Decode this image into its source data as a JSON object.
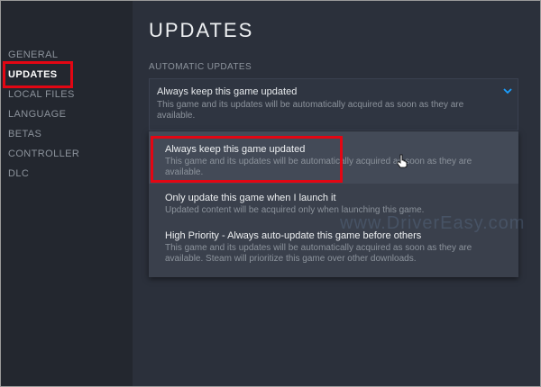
{
  "sidebar": {
    "items": [
      {
        "label": "GENERAL"
      },
      {
        "label": "UPDATES"
      },
      {
        "label": "LOCAL FILES"
      },
      {
        "label": "LANGUAGE"
      },
      {
        "label": "BETAS"
      },
      {
        "label": "CONTROLLER"
      },
      {
        "label": "DLC"
      }
    ],
    "active_index": 1
  },
  "main": {
    "title": "UPDATES",
    "section_label": "AUTOMATIC UPDATES",
    "dropdown": {
      "selected_title": "Always keep this game updated",
      "selected_desc": "This game and its updates will be automatically acquired as soon as they are available.",
      "chevron_icon": "chevron-down-icon"
    },
    "options": [
      {
        "title": "Always keep this game updated",
        "desc": "This game and its updates will be automatically acquired as soon as they are available."
      },
      {
        "title": "Only update this game when I launch it",
        "desc": "Updated content will be acquired only when launching this game."
      },
      {
        "title": "High Priority - Always auto-update this game before others",
        "desc": "This game and its updates will be automatically acquired as soon as they are available. Steam will prioritize this game over other downloads."
      }
    ]
  },
  "watermark": {
    "text": "www.DriverEasy.com"
  },
  "colors": {
    "highlight": "#e30613",
    "accent": "#1a9fff",
    "background": "#2b303b",
    "sidebar": "#23272f"
  }
}
